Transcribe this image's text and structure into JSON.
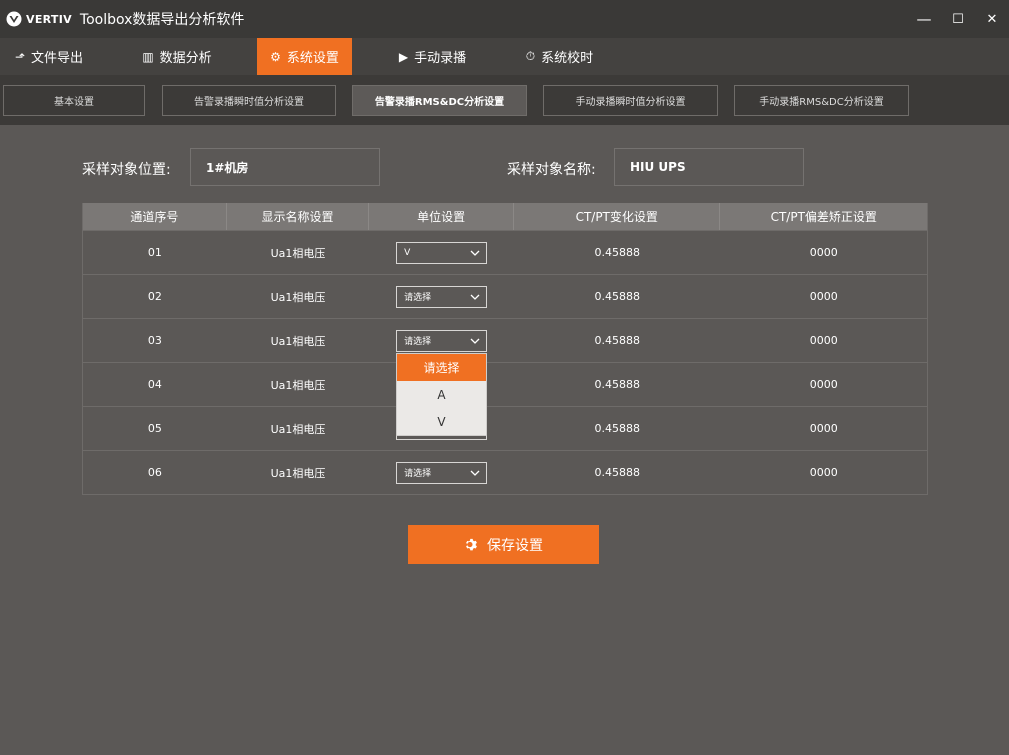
{
  "window": {
    "logo_text": "VERTIV",
    "title": "Toolbox数据导出分析软件",
    "minimize": "—",
    "maximize": "☐",
    "close": "✕"
  },
  "main_menu": [
    {
      "label": "文件导出",
      "icon": "export-icon",
      "glyph": "⬏"
    },
    {
      "label": "数据分析",
      "icon": "chart-icon",
      "glyph": "▥"
    },
    {
      "label": "系统设置",
      "icon": "gear-icon",
      "glyph": "⚙"
    },
    {
      "label": "手动录播",
      "icon": "video-icon",
      "glyph": "▶"
    },
    {
      "label": "系统校时",
      "icon": "timer-icon",
      "glyph": "⏱"
    }
  ],
  "sub_tabs": [
    {
      "label": "基本设置"
    },
    {
      "label": "告警录播瞬时值分析设置"
    },
    {
      "label": "告警录播RMS&DC分析设置"
    },
    {
      "label": "手动录播瞬时值分析设置"
    },
    {
      "label": "手动录播RMS&DC分析设置"
    }
  ],
  "form": {
    "location_label": "采样对象位置:",
    "location_value": "1#机房",
    "name_label": "采样对象名称:",
    "name_value": "HIU UPS"
  },
  "table": {
    "headers": [
      "通道序号",
      "显示名称设置",
      "单位设置",
      "CT/PT变化设置",
      "CT/PT偏差矫正设置"
    ],
    "rows": [
      {
        "channel": "01",
        "name": "Ua1相电压",
        "unit": "V",
        "ct": "0.45888",
        "offset": "0000"
      },
      {
        "channel": "02",
        "name": "Ua1相电压",
        "unit": "请选择",
        "ct": "0.45888",
        "offset": "0000"
      },
      {
        "channel": "03",
        "name": "Ua1相电压",
        "unit": "请选择",
        "ct": "0.45888",
        "offset": "0000"
      },
      {
        "channel": "04",
        "name": "Ua1相电压",
        "unit": "",
        "ct": "0.45888",
        "offset": "0000"
      },
      {
        "channel": "05",
        "name": "Ua1相电压",
        "unit": "",
        "ct": "0.45888",
        "offset": "0000"
      },
      {
        "channel": "06",
        "name": "Ua1相电压",
        "unit": "请选择",
        "ct": "0.45888",
        "offset": "0000"
      }
    ]
  },
  "dropdown": {
    "options": [
      "请选择",
      "A",
      "V"
    ]
  },
  "save_button": {
    "label": "保存设置"
  },
  "colors": {
    "accent": "#f07022",
    "background": "#5b5856",
    "titlebar": "#3a3937"
  }
}
